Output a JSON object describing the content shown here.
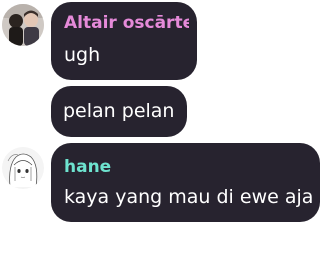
{
  "messages": [
    {
      "sender": "Altair oscārte",
      "sender_color": "#e58ad9",
      "avatar_icon": "user-photo-avatar",
      "lines": [
        "ugh",
        "pelan pelan"
      ]
    },
    {
      "sender": "hane",
      "sender_color": "#6ee3cf",
      "avatar_icon": "anime-girl-avatar",
      "lines": [
        "kaya yang mau di ewe aja"
      ]
    }
  ],
  "colors": {
    "bubble_bg": "#27232f",
    "text": "#ffffff",
    "page_bg": "#ffffff"
  }
}
